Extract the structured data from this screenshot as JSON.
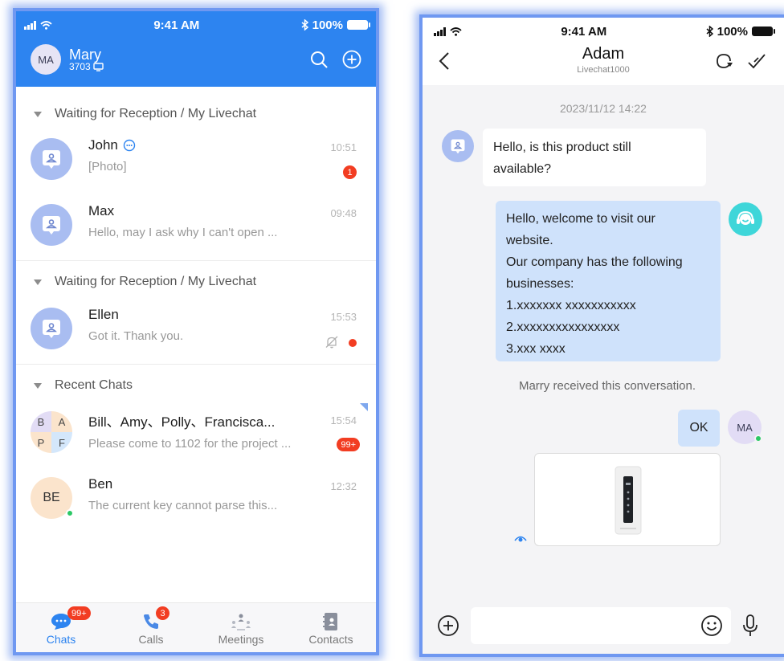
{
  "left": {
    "status": {
      "time": "9:41 AM",
      "battery": "100%"
    },
    "header": {
      "avatar": "MA",
      "name": "Mary",
      "extension": "3703"
    },
    "sections": [
      {
        "title": "Waiting for Reception / My Livechat",
        "items": [
          {
            "name": "John",
            "preview": "[Photo]",
            "time": "10:51",
            "badge": "1"
          },
          {
            "name": "Max",
            "preview": "Hello, may I ask why I can't open ...",
            "time": "09:48"
          }
        ]
      },
      {
        "title": "Waiting for Reception / My Livechat",
        "items": [
          {
            "name": "Ellen",
            "preview": "Got it. Thank you.",
            "time": "15:53"
          }
        ]
      },
      {
        "title": "Recent Chats",
        "items": [
          {
            "name": "Bill、Amy、Polly、Francisca...",
            "preview": "Please come to 1102 for the project ...",
            "time": "15:54",
            "badge": "99+",
            "group_letters": [
              "B",
              "A",
              "P",
              "F"
            ]
          },
          {
            "name": "Ben",
            "preview": "The current key cannot parse this...",
            "time": "12:32",
            "avatar": "BE"
          }
        ]
      }
    ],
    "tabs": [
      {
        "label": "Chats",
        "badge": "99+",
        "icon": "chat-bubble-icon"
      },
      {
        "label": "Calls",
        "badge": "3",
        "icon": "phone-icon"
      },
      {
        "label": "Meetings",
        "icon": "meeting-icon"
      },
      {
        "label": "Contacts",
        "icon": "contacts-book-icon"
      }
    ]
  },
  "right": {
    "status": {
      "time": "9:41 AM",
      "battery": "100%"
    },
    "header": {
      "title": "Adam",
      "subtitle": "Livechat1000"
    },
    "timestamp": "2023/11/12  14:22",
    "messages": {
      "incoming": [
        "Hello, is this product still",
        "available?"
      ],
      "agent": [
        "Hello, welcome to visit our",
        "website.",
        "Our company has the following",
        "businesses:",
        "1.xxxxxxx xxxxxxxxxxx",
        "2.xxxxxxxxxxxxxxxx",
        "3.xxx xxxx"
      ],
      "system": "Marry received this conversation.",
      "reply": "OK",
      "reply_avatar": "MA"
    }
  },
  "colors": {
    "brand_blue": "#2d84f0",
    "badge_red": "#f23d22",
    "online_green": "#2bc865",
    "avatar_blue": "#a9bdf1",
    "bubble_blue": "#cfe2fb",
    "agent_teal": "#3ed6d9"
  }
}
